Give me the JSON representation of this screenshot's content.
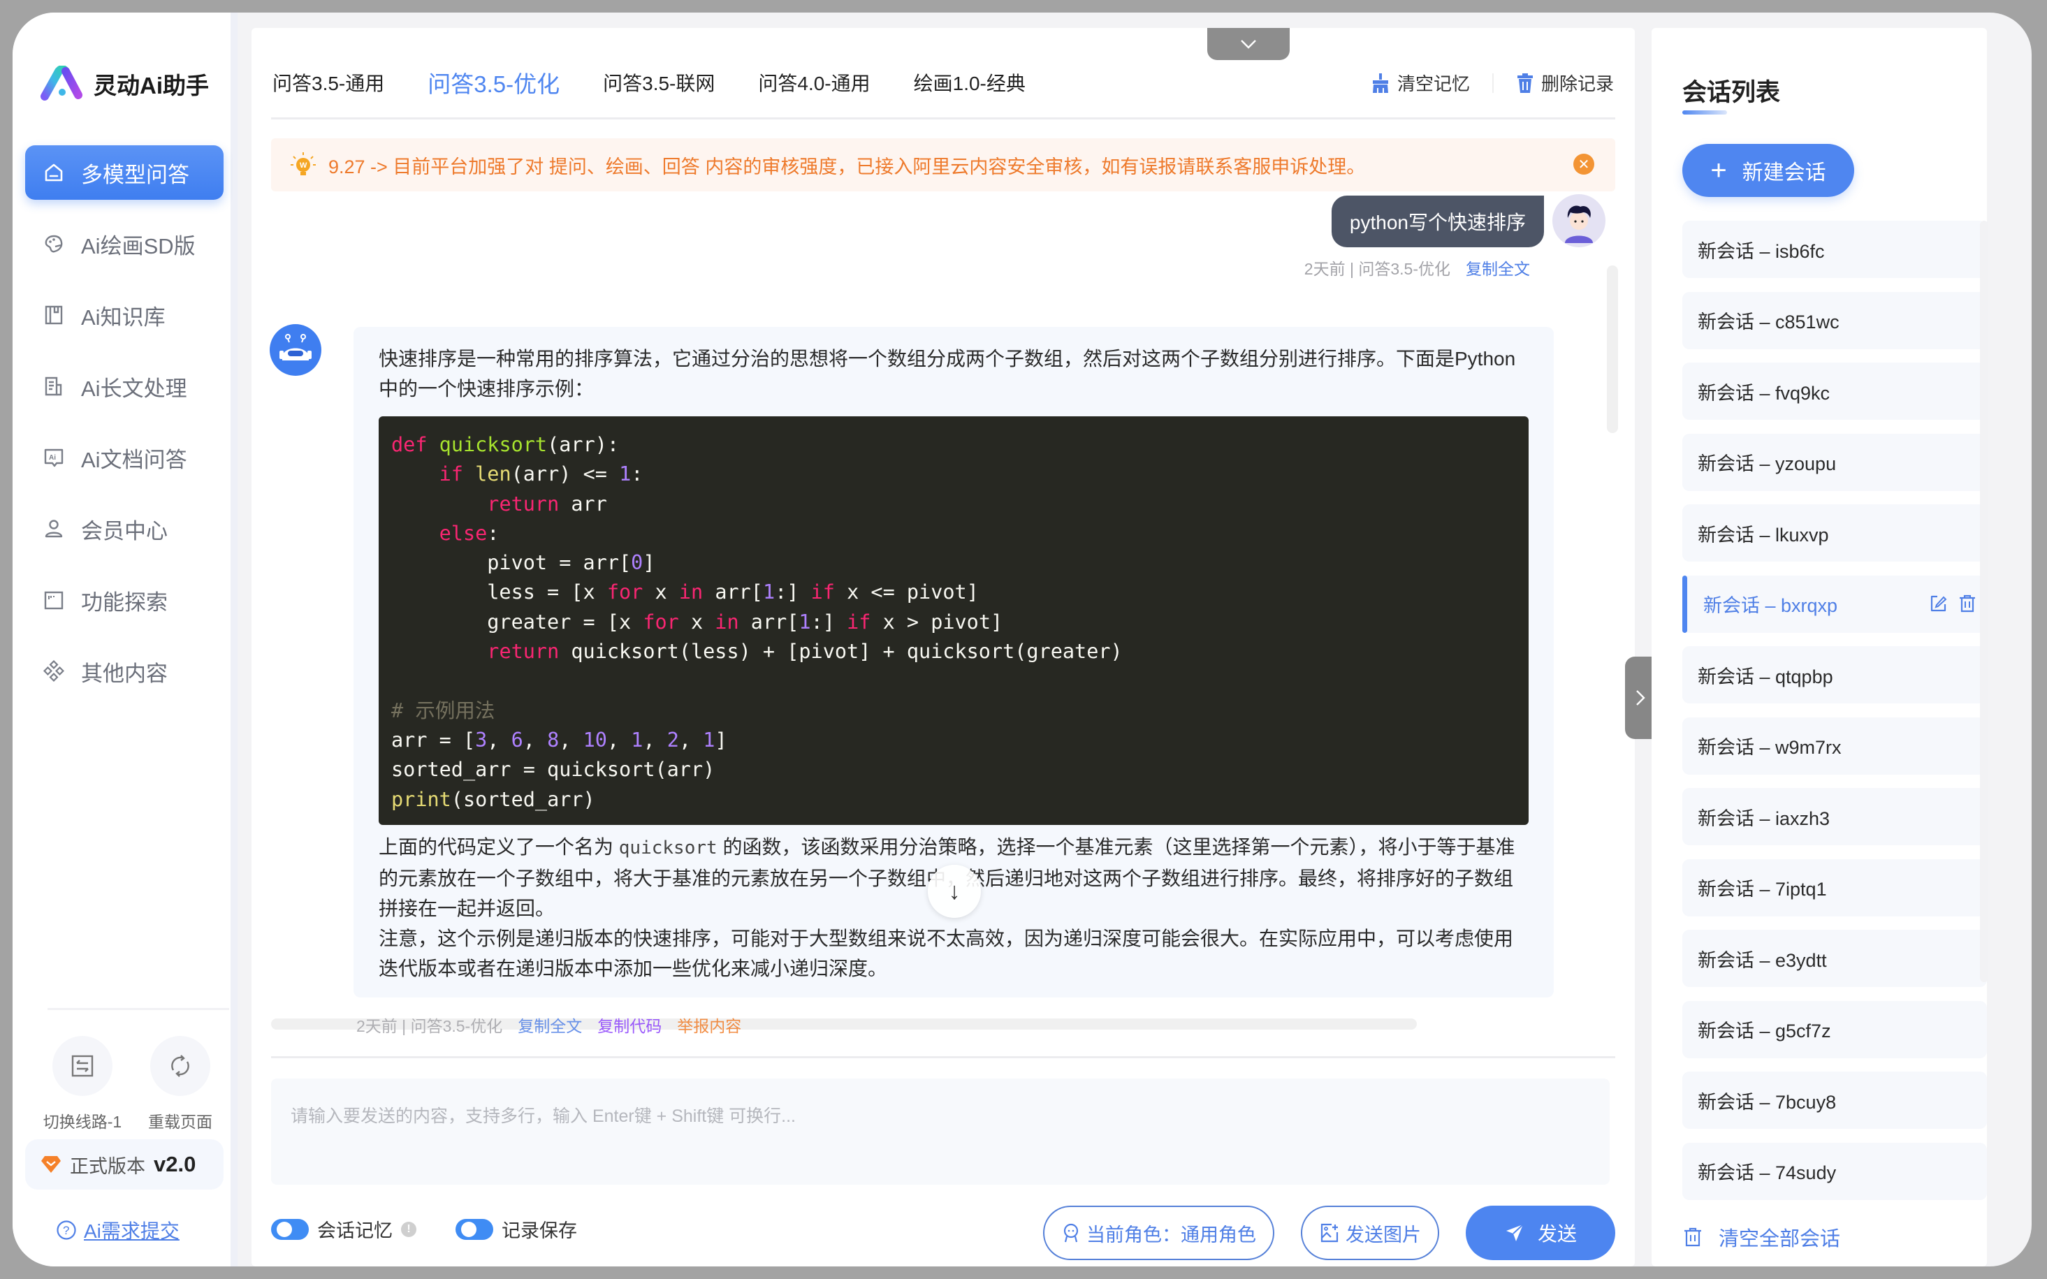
{
  "app": {
    "name": "灵动Ai助手",
    "version_label": "正式版本",
    "version": "v2.0",
    "feedback_link": "Ai需求提交",
    "accent_color": "#4f86f0"
  },
  "sidebar": {
    "items": [
      {
        "label": "多模型问答",
        "icon": "home-icon",
        "active": true
      },
      {
        "label": "Ai绘画SD版",
        "icon": "palette-icon",
        "active": false
      },
      {
        "label": "Ai知识库",
        "icon": "book-icon",
        "active": false
      },
      {
        "label": "Ai长文处理",
        "icon": "document-icon",
        "active": false
      },
      {
        "label": "Ai文档问答",
        "icon": "ai-chat-icon",
        "active": false
      },
      {
        "label": "会员中心",
        "icon": "user-icon",
        "active": false
      },
      {
        "label": "功能探索",
        "icon": "explore-icon",
        "active": false
      },
      {
        "label": "其他内容",
        "icon": "grid-icon",
        "active": false
      }
    ],
    "tools": [
      {
        "label": "切换线路-1",
        "icon": "switch-icon"
      },
      {
        "label": "重载页面",
        "icon": "refresh-icon"
      }
    ]
  },
  "header": {
    "tabs": [
      {
        "label": "问答3.5-通用",
        "active": false
      },
      {
        "label": "问答3.5-优化",
        "active": true
      },
      {
        "label": "问答3.5-联网",
        "active": false
      },
      {
        "label": "问答4.0-通用",
        "active": false
      },
      {
        "label": "绘画1.0-经典",
        "active": false
      }
    ],
    "clear_memory": "清空记忆",
    "delete_records": "删除记录"
  },
  "notice": {
    "text": "9.27 -> 目前平台加强了对 提问、绘画、回答 内容的审核强度，已接入阿里云内容安全审核，如有误报请联系客服申诉处理。"
  },
  "chat": {
    "user_message": {
      "text": "python写个快速排序",
      "time": "2天前",
      "model": "问答3.5-优化",
      "copy_label": "复制全文"
    },
    "bot_message": {
      "intro": "快速排序是一种常用的排序算法，它通过分治的思想将一个数组分成两个子数组，然后对这两个子数组分别进行排序。下面是Python中的一个快速排序示例：",
      "code_lines": [
        "def quicksort(arr):",
        "    if len(arr) <= 1:",
        "        return arr",
        "    else:",
        "        pivot = arr[0]",
        "        less = [x for x in arr[1:] if x <= pivot]",
        "        greater = [x for x in arr[1:] if x > pivot]",
        "        return quicksort(less) + [pivot] + quicksort(greater)",
        "",
        "# 示例用法",
        "arr = [3, 6, 8, 10, 1, 2, 1]",
        "sorted_arr = quicksort(arr)",
        "print(sorted_arr)"
      ],
      "explain_before_code": "上面的代码定义了一个名为 ",
      "explain_code_word": "quicksort",
      "explain_after_code": " 的函数，该函数采用分治策略，选择一个基准元素（这里选择第一个元素），将小于等于基准的元素放在一个子数组中，将大于基准的元素放在另一个子数组中，然后递归地对这两个子数组进行排序。最终，将排序好的子数组拼接在一起并返回。",
      "note": "注意，这个示例是递归版本的快速排序，可能对于大型数组来说不太高效，因为递归深度可能会很大。在实际应用中，可以考虑使用迭代版本或者在递归版本中添加一些优化来减小递归深度。",
      "time": "2天前",
      "model": "问答3.5-优化",
      "copy_all": "复制全文",
      "copy_code": "复制代码",
      "report": "举报内容"
    }
  },
  "input": {
    "placeholder": "请输入要发送的内容，支持多行，输入 Enter键 + Shift键 可换行...",
    "value": ""
  },
  "footer": {
    "toggle_memory": {
      "label": "会话记忆",
      "on": true
    },
    "toggle_save": {
      "label": "记录保存",
      "on": true
    },
    "role_button": "当前角色：通用角色",
    "send_image": "发送图片",
    "send": "发送"
  },
  "sessions": {
    "title": "会话列表",
    "new_button": "新建会话",
    "clear_all": "清空全部会话",
    "items": [
      {
        "label": "新会话 – isb6fc",
        "active": false
      },
      {
        "label": "新会话 – c851wc",
        "active": false
      },
      {
        "label": "新会话 – fvq9kc",
        "active": false
      },
      {
        "label": "新会话 – yzoupu",
        "active": false
      },
      {
        "label": "新会话 – lkuxvp",
        "active": false
      },
      {
        "label": "新会话 – bxrqxp",
        "active": true
      },
      {
        "label": "新会话 – qtqpbp",
        "active": false
      },
      {
        "label": "新会话 – w9m7rx",
        "active": false
      },
      {
        "label": "新会话 – iaxzh3",
        "active": false
      },
      {
        "label": "新会话 – 7iptq1",
        "active": false
      },
      {
        "label": "新会话 – e3ydtt",
        "active": false
      },
      {
        "label": "新会话 – g5cf7z",
        "active": false
      },
      {
        "label": "新会话 – 7bcuy8",
        "active": false
      },
      {
        "label": "新会话 – 74sudy",
        "active": false
      }
    ]
  }
}
